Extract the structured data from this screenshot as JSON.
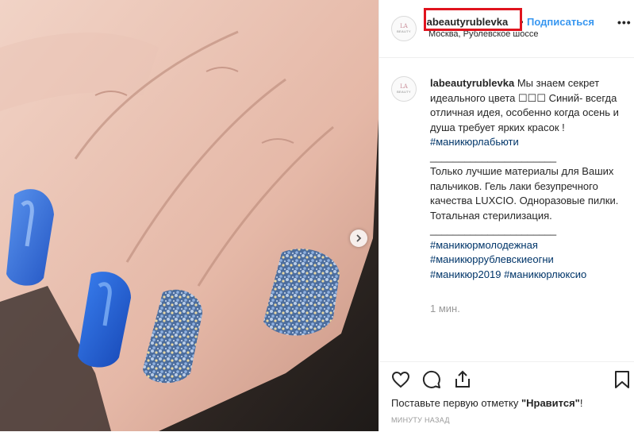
{
  "post": {
    "username": "labeautyrublevka",
    "dot": "•",
    "follow_label": "Подписаться",
    "location": "Москва, Рублевское шоссе",
    "more": "•••",
    "avatar_top": "LA",
    "avatar_bottom": "BEAUTY"
  },
  "caption": {
    "username": "labeautyrublevka",
    "line1": " Мы знаем секрет идеального цвета ☐☐☐ Синий- всегда отличная идея, особенно когда осень и душа требует ярких красок ! ",
    "tag1": "#маникюрлабьюти",
    "divider1": "______________________",
    "line2": "Только лучшие материалы для Ваших пальчиков. Гель лаки безупречного качества LUXCIO. Одноразовые пилки. Тотальная стерилизация.",
    "divider2": "______________________",
    "tag2": "#маникюрмолодежная",
    "tag3": "#маникюррублевскиеогни",
    "tag4": "#маникюр2019",
    "tag5": "#маникюрлюксио",
    "relative_time": "1 мин."
  },
  "footer": {
    "likes_text_pre": "Поставьте первую отметку ",
    "likes_text_bold": "\"Нравится\"",
    "likes_text_post": "!",
    "posted_time": "МИНУТУ НАЗАД"
  },
  "colors": {
    "link": "#3897f0",
    "hashtag": "#003569",
    "highlight": "#e0141e",
    "nail_blue": "#2f6fd6"
  },
  "icons": [
    "heart-icon",
    "comment-icon",
    "share-icon",
    "bookmark-icon",
    "chevron-right-icon"
  ]
}
